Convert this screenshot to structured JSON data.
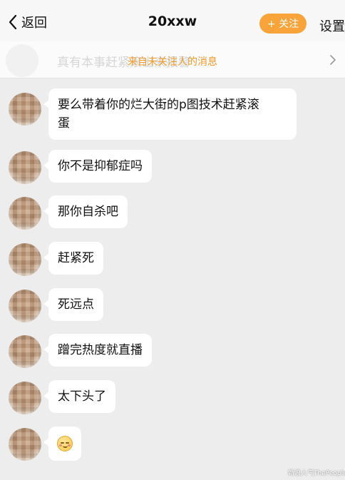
{
  "header": {
    "back_label": "返回",
    "title": "20xxw",
    "follow_label": "+ 关注",
    "settings_label": "设置"
  },
  "notice": {
    "preview_text": "真有本事赶紧滚出来报警",
    "text": "来自未关注人的消息"
  },
  "messages": [
    {
      "line1": "要么带着你的烂大街的p图技术赶紧滚",
      "line2": "蛋"
    },
    {
      "text": "你不是抑郁症吗"
    },
    {
      "text": "那你自杀吧"
    },
    {
      "text": "赶紧死"
    },
    {
      "text": "死远点"
    },
    {
      "text": "蹭完热度就直播"
    },
    {
      "text": "太下头了"
    },
    {
      "emoji": "blushing-face-emoji"
    }
  ],
  "watermark": "新浪人气ThePeople",
  "colors": {
    "accent": "#f9a43a",
    "notice_text": "#f39a2a",
    "background": "#ededed",
    "bubble": "#ffffff"
  }
}
